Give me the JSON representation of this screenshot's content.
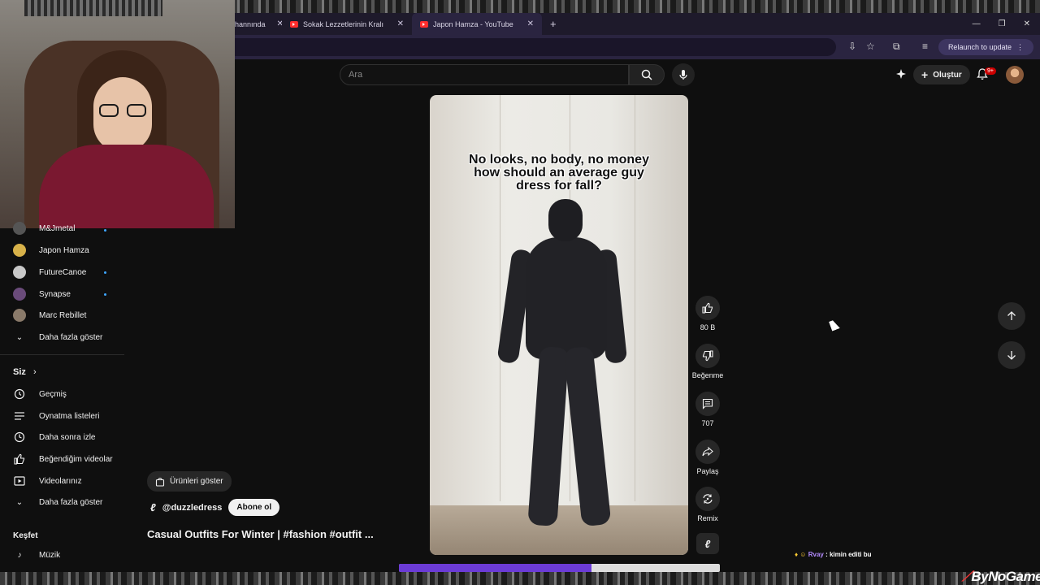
{
  "browser": {
    "tabs": [
      {
        "label": "hannında",
        "partial": true
      },
      {
        "label": "Sokak Lezzetlerinin Kralı baha…"
      },
      {
        "label": "Japon Hamza - YouTube"
      }
    ],
    "relaunch_label": "Relaunch to update"
  },
  "header": {
    "search_placeholder": "Ara",
    "create_label": "Oluştur",
    "notif_badge": "9+"
  },
  "sidebar": {
    "subscriptions": [
      {
        "label": "M&Jmetal",
        "new": true
      },
      {
        "label": "Japon Hamza",
        "new": false
      },
      {
        "label": "FutureCanoe",
        "new": true
      },
      {
        "label": "Synapse",
        "new": true
      },
      {
        "label": "Marc Rebillet",
        "new": false
      }
    ],
    "show_more": "Daha fazla göster",
    "you_section": "Siz",
    "you_items": [
      {
        "label": "Geçmiş",
        "icon": "history-icon"
      },
      {
        "label": "Oynatma listeleri",
        "icon": "playlist-icon"
      },
      {
        "label": "Daha sonra izle",
        "icon": "clock-icon"
      },
      {
        "label": "Beğendiğim videolar",
        "icon": "thumbs-up-icon"
      },
      {
        "label": "Videolarınız",
        "icon": "video-icon"
      }
    ],
    "show_more_2": "Daha fazla göster",
    "explore_section": "Keşfet",
    "explore_items": [
      {
        "label": "Müzik",
        "icon": "music-note-icon"
      }
    ]
  },
  "short": {
    "caption_lines": [
      "No looks, no body, no money",
      "how should an average guy",
      "dress for fall?"
    ],
    "like_count": "80 B",
    "dislike_label": "Beğenme",
    "comment_count": "707",
    "share_label": "Paylaş",
    "remix_label": "Remix",
    "products_label": "Ürünleri göster",
    "channel_handle": "@duzzledress",
    "subscribe_label": "Abone ol",
    "title": "Casual Outfits For Winter | #fashion #outfit ...",
    "progress": 0.6
  },
  "overlay": {
    "chat_nick": "Rvay",
    "chat_msg": ": kimin editi bu",
    "brand": "ByNoGame"
  },
  "colors": {
    "accent": "#3ea6ff",
    "progress": "#6b3bd6",
    "subscribe_bg": "#f1f1f1"
  }
}
